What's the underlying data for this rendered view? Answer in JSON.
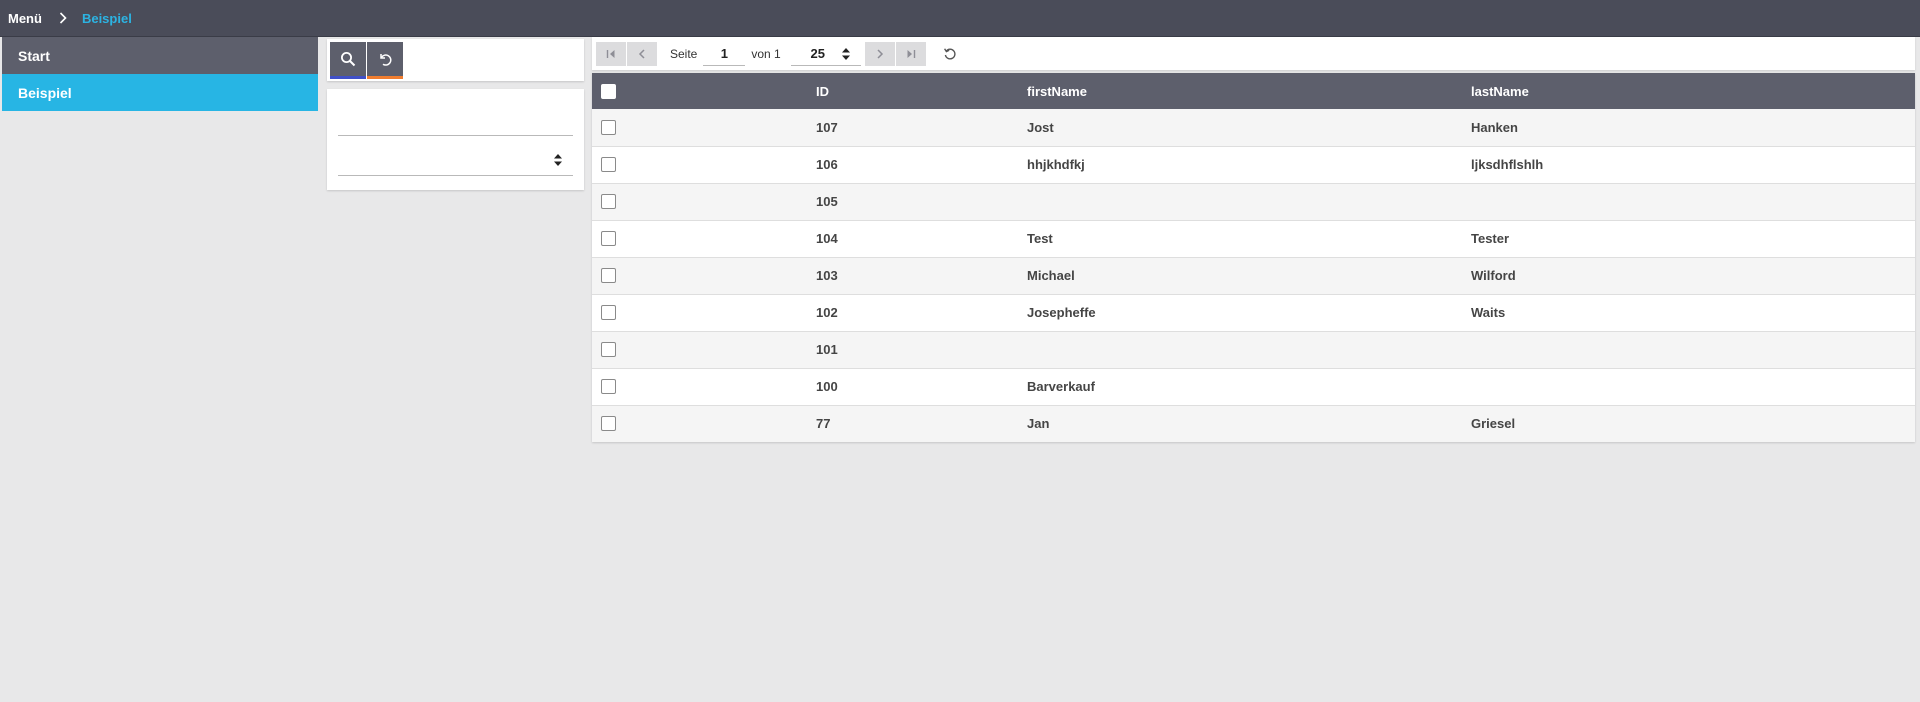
{
  "breadcrumb": {
    "root": "Menü",
    "current": "Beispiel"
  },
  "sidebar": {
    "items": [
      {
        "label": "Start",
        "active": false
      },
      {
        "label": "Beispiel",
        "active": true
      }
    ]
  },
  "filter": {
    "search_icon": "search-icon",
    "reset_icon": "undo-icon",
    "text_value": "",
    "select_value": ""
  },
  "pager": {
    "page_label": "Seite",
    "current_page": "1",
    "of_label": "von 1",
    "page_size": "25"
  },
  "table": {
    "columns": [
      "ID",
      "firstName",
      "lastName"
    ],
    "rows": [
      {
        "id": "107",
        "firstName": "Jost",
        "lastName": "Hanken"
      },
      {
        "id": "106",
        "firstName": "hhjkhdfkj",
        "lastName": "ljksdhflshlh"
      },
      {
        "id": "105",
        "firstName": "",
        "lastName": ""
      },
      {
        "id": "104",
        "firstName": "Test",
        "lastName": "Tester"
      },
      {
        "id": "103",
        "firstName": "Michael",
        "lastName": "Wilford"
      },
      {
        "id": "102",
        "firstName": "Josepheffe",
        "lastName": "Waits"
      },
      {
        "id": "101",
        "firstName": "",
        "lastName": ""
      },
      {
        "id": "100",
        "firstName": "Barverkauf",
        "lastName": ""
      },
      {
        "id": "77",
        "firstName": "Jan",
        "lastName": "Griesel"
      }
    ]
  },
  "colors": {
    "topbar": "#4a4c59",
    "accent": "#27b5e4",
    "header": "#5d5f6c",
    "search_underline": "#4050c8",
    "reset_underline": "#f07d2f"
  }
}
